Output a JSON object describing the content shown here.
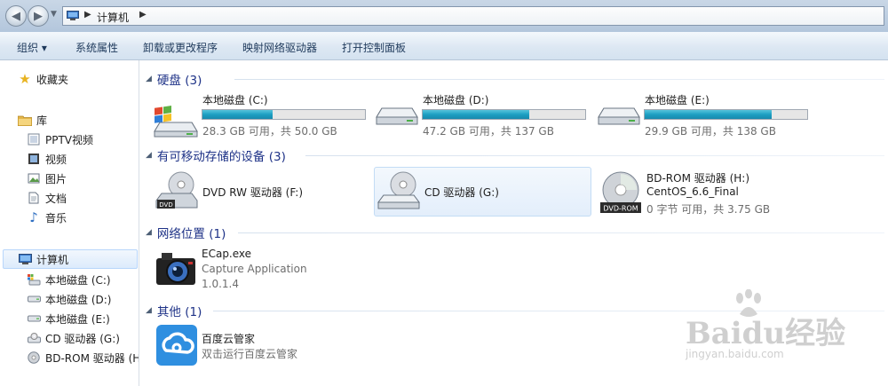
{
  "address_bar": {
    "back": "back-arrow-icon",
    "forward": "forward-arrow-icon",
    "breadcrumb": "计算机"
  },
  "toolbar": {
    "organize": "组织 ▾",
    "system_properties": "系统属性",
    "uninstall": "卸载或更改程序",
    "map_drive": "映射网络驱动器",
    "control_panel": "打开控制面板"
  },
  "nav": {
    "favorites": "收藏夹",
    "library": "库",
    "library_items": [
      "PPTV视频",
      "视频",
      "图片",
      "文档",
      "音乐"
    ],
    "computer": "计算机",
    "computer_items": [
      "本地磁盘 (C:)",
      "本地磁盘 (D:)",
      "本地磁盘 (E:)",
      "CD 驱动器 (G:)",
      "BD-ROM 驱动器 (H"
    ]
  },
  "groups": {
    "hdd": "硬盘 (3)",
    "removable": "有可移动存储的设备 (3)",
    "network": "网络位置 (1)",
    "other": "其他 (1)"
  },
  "drives": [
    {
      "name": "本地磁盘 (C:)",
      "info": "28.3 GB 可用，共 50.0 GB",
      "used_fraction": 0.434
    },
    {
      "name": "本地磁盘 (D:)",
      "info": "47.2 GB 可用，共 137 GB",
      "used_fraction": 0.655
    },
    {
      "name": "本地磁盘 (E:)",
      "info": "29.9 GB 可用，共 138 GB",
      "used_fraction": 0.783
    }
  ],
  "removable": [
    {
      "name": "DVD RW 驱动器 (F:)"
    },
    {
      "name": "CD 驱动器 (G:)"
    },
    {
      "name": "BD-ROM 驱动器 (H:)",
      "label": "CentOS_6.6_Final",
      "info": "0 字节 可用，共 3.75 GB"
    }
  ],
  "network_item": {
    "name": "ECap.exe",
    "desc": "Capture Application",
    "version": "1.0.1.4"
  },
  "other_item": {
    "name": "百度云管家",
    "desc": "双击运行百度云管家"
  },
  "watermark": {
    "text": "Baidu经验",
    "url": "jingyan.baidu.com"
  },
  "colors": {
    "group_header": "#1e3287",
    "bar_fill": "#1d9fc2",
    "toolbar_text": "#1e395b"
  }
}
